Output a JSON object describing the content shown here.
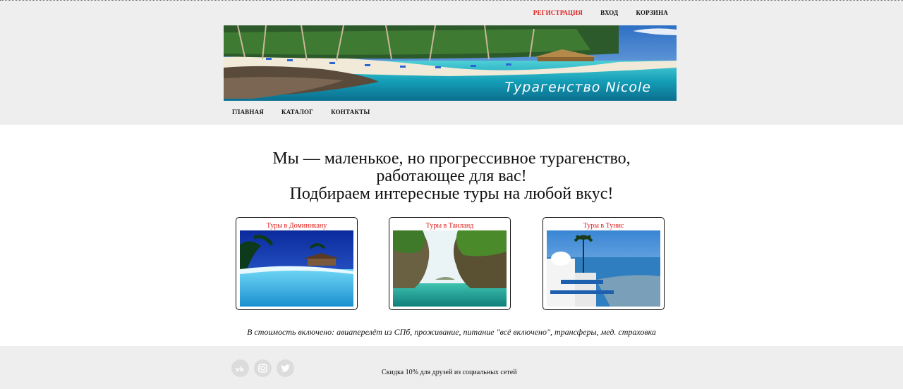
{
  "topnav": {
    "items": [
      {
        "label": "РЕГИСТРАЦИЯ",
        "active": true
      },
      {
        "label": "ВХОД",
        "active": false
      },
      {
        "label": "КОРЗИНА",
        "active": false
      }
    ]
  },
  "banner": {
    "title": "Турагенство Nicole"
  },
  "mainnav": {
    "items": [
      {
        "label": "ГЛАВНАЯ"
      },
      {
        "label": "КАТАЛОГ"
      },
      {
        "label": "КОНТАКТЫ"
      }
    ]
  },
  "hero": {
    "line1": "Мы — маленькое, но прогрессивное турагенство,",
    "line2": "работающее для вас!",
    "line3": "Подбираем интересные туры на любой вкус!"
  },
  "cards": [
    {
      "title": "Туры в Доминикану"
    },
    {
      "title": "Туры в Таиланд"
    },
    {
      "title": "Туры в Тунис"
    }
  ],
  "included": {
    "text": "В стоимость включено: авиаперелёт из СПб, проживание, питание \"всё включено\", трансферы, мед. страховка"
  },
  "footer": {
    "social_icons": [
      "vk-icon",
      "instagram-icon",
      "twitter-icon"
    ],
    "text": "Скидка 10% для друзей из социальных сетей"
  },
  "colors": {
    "accent": "#e0201c",
    "band": "#eeeeee"
  }
}
